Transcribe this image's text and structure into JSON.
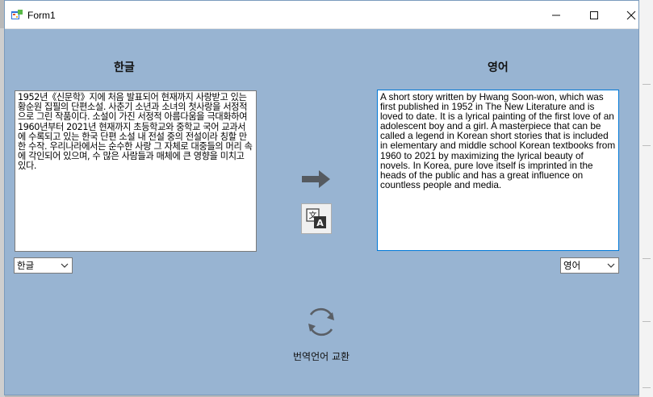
{
  "window": {
    "title": "Form1"
  },
  "labels": {
    "source_language": "한글",
    "target_language": "영어"
  },
  "source_text": "1952년《신문학》지에 처음 발표되어 현재까지 사랑받고 있는 황순원 집필의 단편소설. 사춘기 소년과 소녀의 첫사랑을 서정적으로 그린 작품이다. 소설이 가진 서정적 아름다움을 극대화하여 1960년부터 2021년 현재까지 초등학교와 중학교 국어 교과서에 수록되고 있는 한국 단편 소설 내 전설 중의 전설이라 칭할 만한 수작. 우리나라에서는 순수한 사랑 그 자체로 대중들의 머리 속에 각인되어 있으며, 수 많은 사람들과 매체에 큰 영향을 미치고 있다.",
  "target_text": "A short story written by Hwang Soon-won, which was first published in 1952 in The New Literature and is loved to date. It is a lyrical painting of the first love of an adolescent boy and a girl. A masterpiece that can be called a legend in Korean short stories that is included in elementary and middle school Korean textbooks from 1960 to 2021 by maximizing the lyrical beauty of novels. In Korea, pure love itself is imprinted in the heads of the public and has a great influence on countless people and media.",
  "combo_source": {
    "selected": "한글"
  },
  "combo_target": {
    "selected": "영어"
  },
  "swap_label": "번역언어 교환",
  "colors": {
    "form_background": "#98b4d2",
    "accent_border": "#0078d7"
  }
}
